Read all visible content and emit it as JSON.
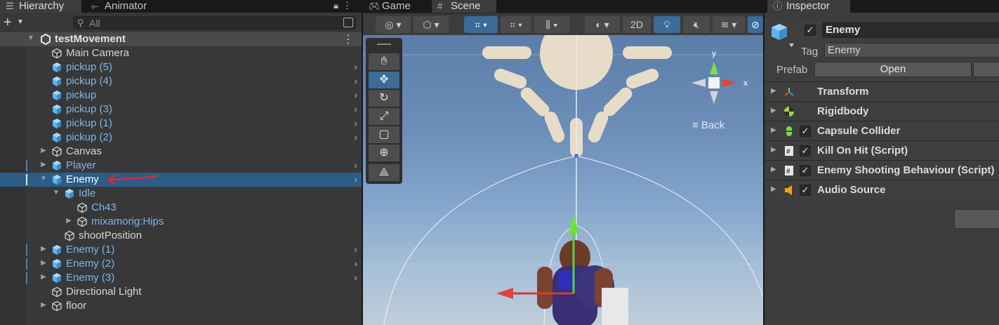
{
  "hierarchy": {
    "tab_label": "Hierarchy",
    "animator_tab_label": "Animator",
    "search_placeholder": "All",
    "scene_name": "testMovement",
    "items": [
      {
        "label": "Main Camera"
      },
      {
        "label": "pickup (5)"
      },
      {
        "label": "pickup (4)"
      },
      {
        "label": "pickup"
      },
      {
        "label": "pickup (3)"
      },
      {
        "label": "pickup (1)"
      },
      {
        "label": "pickup (2)"
      },
      {
        "label": "Canvas"
      },
      {
        "label": "Player"
      },
      {
        "label": "Enemy"
      },
      {
        "label": "Idle"
      },
      {
        "label": "Ch43"
      },
      {
        "label": "mixamorig:Hips"
      },
      {
        "label": "shootPosition"
      },
      {
        "label": "Enemy (1)"
      },
      {
        "label": "Enemy (2)"
      },
      {
        "label": "Enemy (3)"
      },
      {
        "label": "Directional Light"
      },
      {
        "label": "floor"
      }
    ],
    "selected_item": "Enemy"
  },
  "scene_view": {
    "game_tab_label": "Game",
    "scene_tab_label": "Scene",
    "mode_2d_label": "2D",
    "back_label": "Back",
    "gizmo_y_label": "y",
    "gizmo_x_label": "x"
  },
  "inspector": {
    "tab_label": "Inspector",
    "object_name": "Enemy",
    "tag_label": "Tag",
    "tag_value": "Enemy",
    "prefab_label": "Prefab",
    "open_label": "Open",
    "components": [
      {
        "name": "Transform",
        "icon": "transform-icon"
      },
      {
        "name": "Rigidbody",
        "icon": "rigidbody-icon"
      },
      {
        "name": "Capsule Collider",
        "icon": "capsule-collider-icon"
      },
      {
        "name": "Kill On Hit (Script)",
        "icon": "script-icon"
      },
      {
        "name": "Enemy Shooting Behaviour (Script)",
        "icon": "script-icon"
      },
      {
        "name": "Audio Source",
        "icon": "audio-source-icon"
      }
    ]
  },
  "colors": {
    "selection": "#2c5d87",
    "prefab_text": "#7bb6ee",
    "annotation_arrow": "#e0272f"
  }
}
